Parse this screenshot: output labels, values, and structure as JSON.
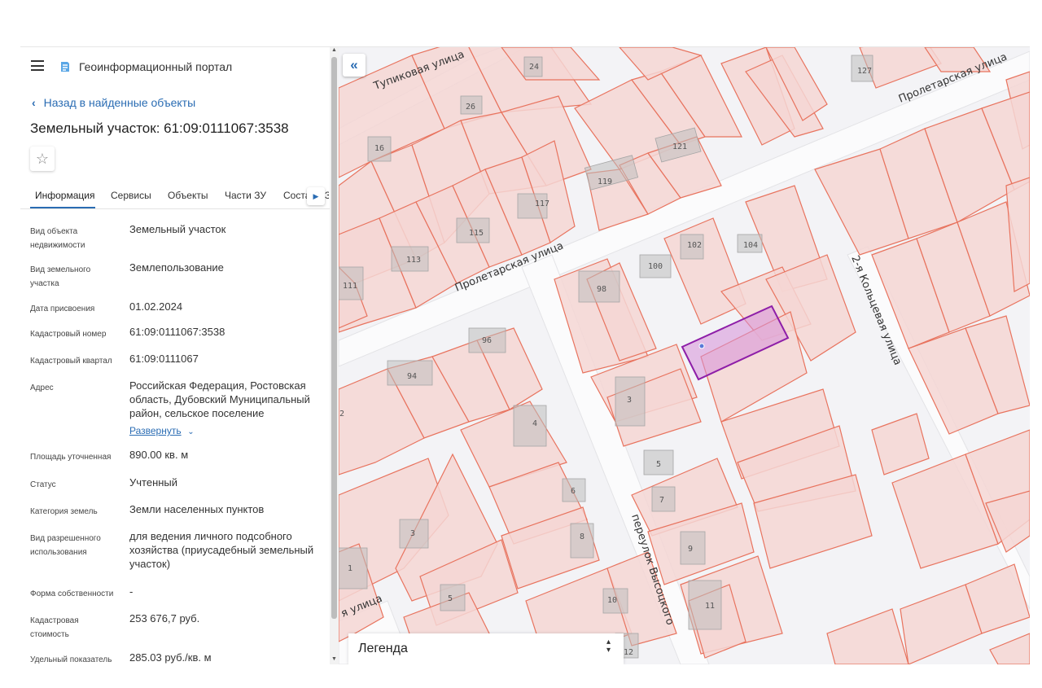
{
  "app": {
    "title": "Геоинформационный портал"
  },
  "nav": {
    "back_label": "Назад в найденные объекты"
  },
  "page": {
    "title": "Земельный участок: 61:09:0111067:3538"
  },
  "tabs": [
    "Информация",
    "Сервисы",
    "Объекты",
    "Части ЗУ",
    "Состав ЕЗ"
  ],
  "fields": [
    {
      "label": "Вид объекта недвижимости",
      "value": "Земельный участок"
    },
    {
      "label": "Вид земельного участка",
      "value": "Землепользование"
    },
    {
      "label": "Дата присвоения",
      "value": "01.02.2024"
    },
    {
      "label": "Кадастровый номер",
      "value": "61:09:0111067:3538"
    },
    {
      "label": "Кадастровый квартал",
      "value": "61:09:0111067"
    },
    {
      "label": "Адрес",
      "value": "Российская Федерация, Ростовская область, Дубовский Муниципальный район, сельское поселение"
    },
    {
      "label": "Площадь уточненная",
      "value": "890.00 кв. м"
    },
    {
      "label": "Статус",
      "value": "Учтенный"
    },
    {
      "label": "Категория земель",
      "value": "Земли населенных пунктов"
    },
    {
      "label": "Вид разрешенного использования",
      "value": "для ведения личного подсобного хозяйства (приусадебный земельный участок)"
    },
    {
      "label": "Форма собственности",
      "value": "-"
    },
    {
      "label": "Кадастровая стоимость",
      "value": "253 676,7 руб."
    },
    {
      "label": "Удельный показатель",
      "value": "285.03 руб./кв. м"
    }
  ],
  "address_expand": "Развернуть",
  "map": {
    "streets": [
      "Тупиковая улица",
      "Пролетарская улица",
      "Пролетарская улица",
      "2-я Кольцевая улица",
      "переулок Высоцкого",
      "я улица"
    ],
    "parcel_numbers": [
      "24",
      "127",
      "26",
      "16",
      "121",
      "119",
      "117",
      "115",
      "113",
      "111",
      "102",
      "104",
      "100",
      "98",
      "96",
      "94",
      "2",
      "3",
      "4",
      "5",
      "6",
      "7",
      "8",
      "9",
      "3",
      "1",
      "5",
      "10",
      "11",
      "12"
    ],
    "legend_label": "Легенда",
    "selected_color": "#8e1ea8",
    "parcel_color": "#e8735e"
  }
}
